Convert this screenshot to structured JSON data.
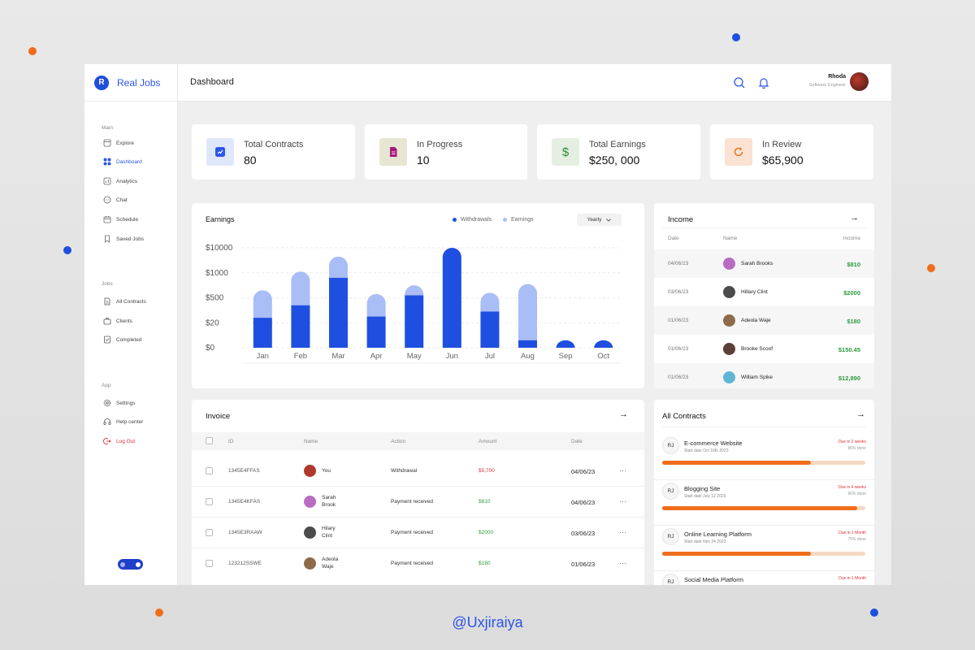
{
  "app": {
    "name": "Real Jobs",
    "logo_letter": "R"
  },
  "header": {
    "title": "Dashboard",
    "user_name": "Rhoda",
    "user_role": "Software Engineer"
  },
  "sidebar": {
    "sections": [
      {
        "title": "Main",
        "items": [
          "Explore",
          "Dashboard",
          "Analytics",
          "Chat",
          "Schedule",
          "Saved Jobs"
        ]
      },
      {
        "title": "Jobs",
        "items": [
          "All Contracts",
          "Clients",
          "Completed"
        ]
      },
      {
        "title": "App",
        "items": [
          "Settings",
          "Help center",
          "Log Out"
        ]
      }
    ],
    "active": "Dashboard"
  },
  "stats": [
    {
      "label": "Total Contracts",
      "value": "80",
      "color": "#dfe7fb"
    },
    {
      "label": "In Progress",
      "value": "10",
      "color": "#e6e6d2"
    },
    {
      "label": "Total Earnings",
      "value": "$250, 000",
      "color": "#e4efe2"
    },
    {
      "label": "In Review",
      "value": "$65,900",
      "color": "#fbe2d3"
    }
  ],
  "chart_data": {
    "type": "bar",
    "title": "Earnings",
    "filter": "Yearly",
    "categories": [
      "Jan",
      "Feb",
      "Mar",
      "Apr",
      "May",
      "Jun",
      "Jul",
      "Aug",
      "Sep",
      "Oct"
    ],
    "y_ticks": [
      "$10000",
      "$1000",
      "$500",
      "$20",
      "$0"
    ],
    "tick_positions": [
      4,
      3,
      2,
      1,
      0
    ],
    "ylim": [
      0,
      4
    ],
    "series": [
      {
        "name": "Withdrawals",
        "color": "#1f4fe0",
        "values": [
          1.2,
          1.7,
          2.8,
          1.25,
          2.1,
          4.0,
          1.45,
          0.3,
          0.3,
          0.3
        ]
      },
      {
        "name": "Earnings",
        "color": "#a9bdf6",
        "values": [
          1.1,
          1.35,
          0.85,
          0.9,
          0.4,
          0,
          0.75,
          2.25,
          0,
          0
        ]
      }
    ],
    "grid": true,
    "legend": "top-right"
  },
  "income": {
    "title": "Income",
    "headers": [
      "Date",
      "Name",
      "Income"
    ],
    "rows": [
      {
        "date": "04/06/23",
        "name": "Sarah Brooks",
        "amount": "$810",
        "avatar": "#b96cc1"
      },
      {
        "date": "03/06/23",
        "name": "Hillary Clint",
        "amount": "$2000",
        "avatar": "#4b4b4b"
      },
      {
        "date": "01/06/23",
        "name": "Adeola Waje",
        "amount": "$180",
        "avatar": "#8d6b4b"
      },
      {
        "date": "01/06/23",
        "name": "Brooke Scoof",
        "amount": "$150.45",
        "avatar": "#5a4036"
      },
      {
        "date": "01/06/23",
        "name": "William Spike",
        "amount": "$12,890",
        "avatar": "#5fb5d8"
      }
    ]
  },
  "invoice": {
    "title": "Invoice",
    "headers": [
      "ID",
      "Name",
      "Action",
      "Amount",
      "Date"
    ],
    "rows": [
      {
        "id": "1345E4FFAS",
        "name1": "You",
        "name2": "",
        "action": "Withdrawal",
        "amount": "$5,700",
        "amount_color": "#e0313b",
        "date": "04/06/23",
        "avatar": "#b0392b"
      },
      {
        "id": "1345E4KFAS",
        "name1": "Sarah",
        "name2": "Brook",
        "action": "Payment received",
        "amount": "$810",
        "amount_color": "#2e9a3e",
        "date": "04/06/23",
        "avatar": "#b96cc1"
      },
      {
        "id": "1345E3RAAW",
        "name1": "Hilary",
        "name2": "Clint",
        "action": "Payment received",
        "amount": "$2000",
        "amount_color": "#2e9a3e",
        "date": "03/06/23",
        "avatar": "#4b4b4b"
      },
      {
        "id": "123212SSWE",
        "name1": "Adeola",
        "name2": "Waje",
        "action": "Payment received",
        "amount": "$180",
        "amount_color": "#2e9a3e",
        "date": "01/06/23",
        "avatar": "#8d6b4b"
      }
    ],
    "more": "···"
  },
  "contracts": {
    "title": "All Contracts",
    "items": [
      {
        "initials": "RJ",
        "title": "E-commerce Website",
        "start": "Start date Oct 16th 2023",
        "due": "Due in 2 weeks",
        "done": "85% done",
        "progress": 0.73
      },
      {
        "initials": "RJ",
        "title": "Blogging Site",
        "start": "Start date July 12 2023",
        "due": "Due in 4 weeks",
        "done": "96% done",
        "progress": 0.96
      },
      {
        "initials": "RJ",
        "title": "Online Learning Platform",
        "start": "Start date Nov 24 2023",
        "due": "Due in 1 Month",
        "done": "75% done",
        "progress": 0.73
      },
      {
        "initials": "RJ",
        "title": "Social Media Platform",
        "start": "",
        "due": "Due in 1 Month",
        "done": "",
        "progress": null
      }
    ]
  },
  "credit": "@Uxjiraiya",
  "colors": {
    "accent": "#2d55e8",
    "orange": "#ef6d1b",
    "danger": "#e0313b",
    "success": "#2e9a3e"
  }
}
